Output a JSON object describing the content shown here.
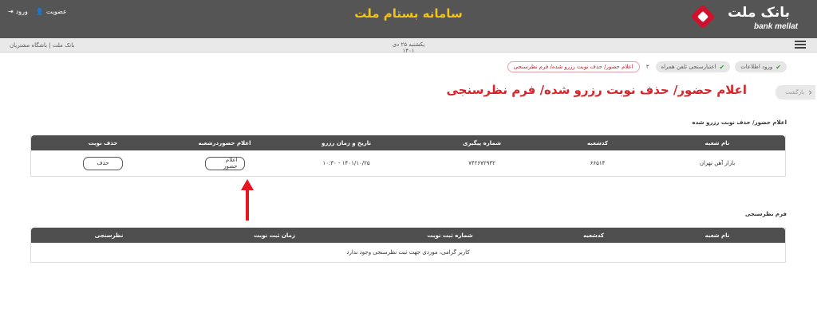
{
  "header": {
    "title": "سامانه بستام ملت",
    "logo_fa": "بانک ملت",
    "logo_en": "bank mellat",
    "login_label": "ورود",
    "register_label": "عضویت"
  },
  "subbar": {
    "date_line1": "یکشنبه ۲۵ دی",
    "date_line2": "۱۴۰۱",
    "links": "بانک ملت | باشگاه مشتریان"
  },
  "breadcrumbs": [
    {
      "label": "ورود اطلاعات",
      "state": "done"
    },
    {
      "label": "اعتبارسنجی تلفن همراه",
      "state": "done"
    },
    {
      "label": "۳",
      "state": "num"
    },
    {
      "label": "اعلام حضور/ حذف نوبت رزرو شده/ فرم نظرسنجی",
      "state": "active"
    }
  ],
  "back_label": "بازگشت",
  "page_title": "اعلام حضور/ حذف نوبت رزرو شده/ فرم نظرسنجی",
  "reservations": {
    "section_label": "اعلام حضور/ حذف نوبت رزرو شده",
    "headers": [
      "نام شعبه",
      "کدشعبه",
      "شماره پیگیری",
      "تاریخ و زمان رزرو",
      "اعلام حضوردرشعبه",
      "حذف نوبت"
    ],
    "row": {
      "branch_name": "بازار آهن تهران",
      "branch_code": "۶۶۵۱۴",
      "tracking_number": "۷۴۲۶۷۲۹۳۲",
      "datetime": "۱۴۰۱/۱۰/۲۵ - ۱۰:۳۰",
      "attend_button": "اعلام حضور",
      "delete_button": "حذف"
    }
  },
  "survey": {
    "section_label": "فرم نظرسنجی",
    "headers": [
      "نام شعبه",
      "کدشعبه",
      "شماره ثبت نوبت",
      "زمان ثبت نوبت",
      "نظرسنجی"
    ],
    "empty_message": "کاربر گرامی، موردی جهت ثبت نظرسنجی وجود ندارد"
  },
  "colors": {
    "header_bg": "#555555",
    "title_yellow": "#f2c31a",
    "brand_red": "#d7262b",
    "table_head": "#4e4e4e",
    "check_green": "#2e9c36",
    "arrow_red": "#e8141f"
  }
}
